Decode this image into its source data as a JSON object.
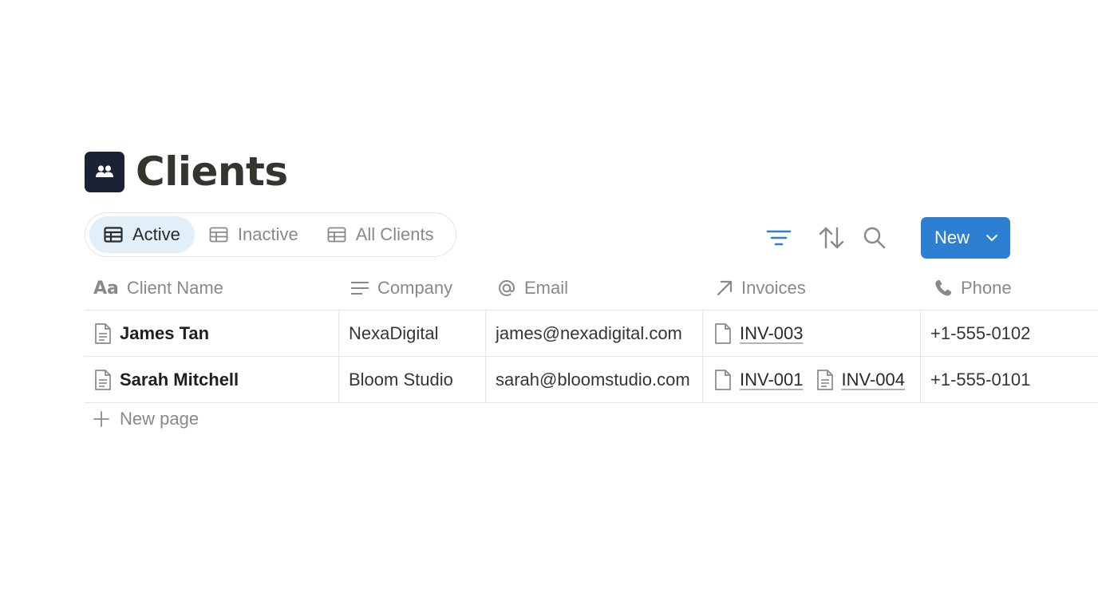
{
  "page": {
    "title": "Clients",
    "icon": "people-icon"
  },
  "views": [
    {
      "label": "Active",
      "icon": "table-icon",
      "selected": true
    },
    {
      "label": "Inactive",
      "icon": "table-icon",
      "selected": false
    },
    {
      "label": "All Clients",
      "icon": "table-icon",
      "selected": false
    }
  ],
  "toolbar": {
    "filter_icon": "filter-icon",
    "sort_icon": "sort-icon",
    "search_icon": "search-icon",
    "new_label": "New",
    "new_dropdown_icon": "chevron-down-icon"
  },
  "columns": [
    {
      "label": "Client Name",
      "icon": "title-aa-icon"
    },
    {
      "label": "Company",
      "icon": "text-lines-icon"
    },
    {
      "label": "Email",
      "icon": "at-sign-icon"
    },
    {
      "label": "Invoices",
      "icon": "relation-arrow-icon"
    },
    {
      "label": "Phone",
      "icon": "phone-icon"
    }
  ],
  "rows": [
    {
      "name": "James Tan",
      "company": "NexaDigital",
      "email": "james@nexadigital.com",
      "invoices": [
        "INV-003"
      ],
      "phone": "+1-555-0102"
    },
    {
      "name": "Sarah Mitchell",
      "company": "Bloom Studio",
      "email": "sarah@bloomstudio.com",
      "invoices": [
        "INV-001",
        "INV-004"
      ],
      "phone": "+1-555-0101"
    }
  ],
  "footer": {
    "new_page_label": "New page"
  },
  "colors": {
    "accent": "#2d7fd3",
    "active_tab_bg": "#e2eff8",
    "page_icon_bg": "#1b2236",
    "muted_text": "#8a8985"
  }
}
